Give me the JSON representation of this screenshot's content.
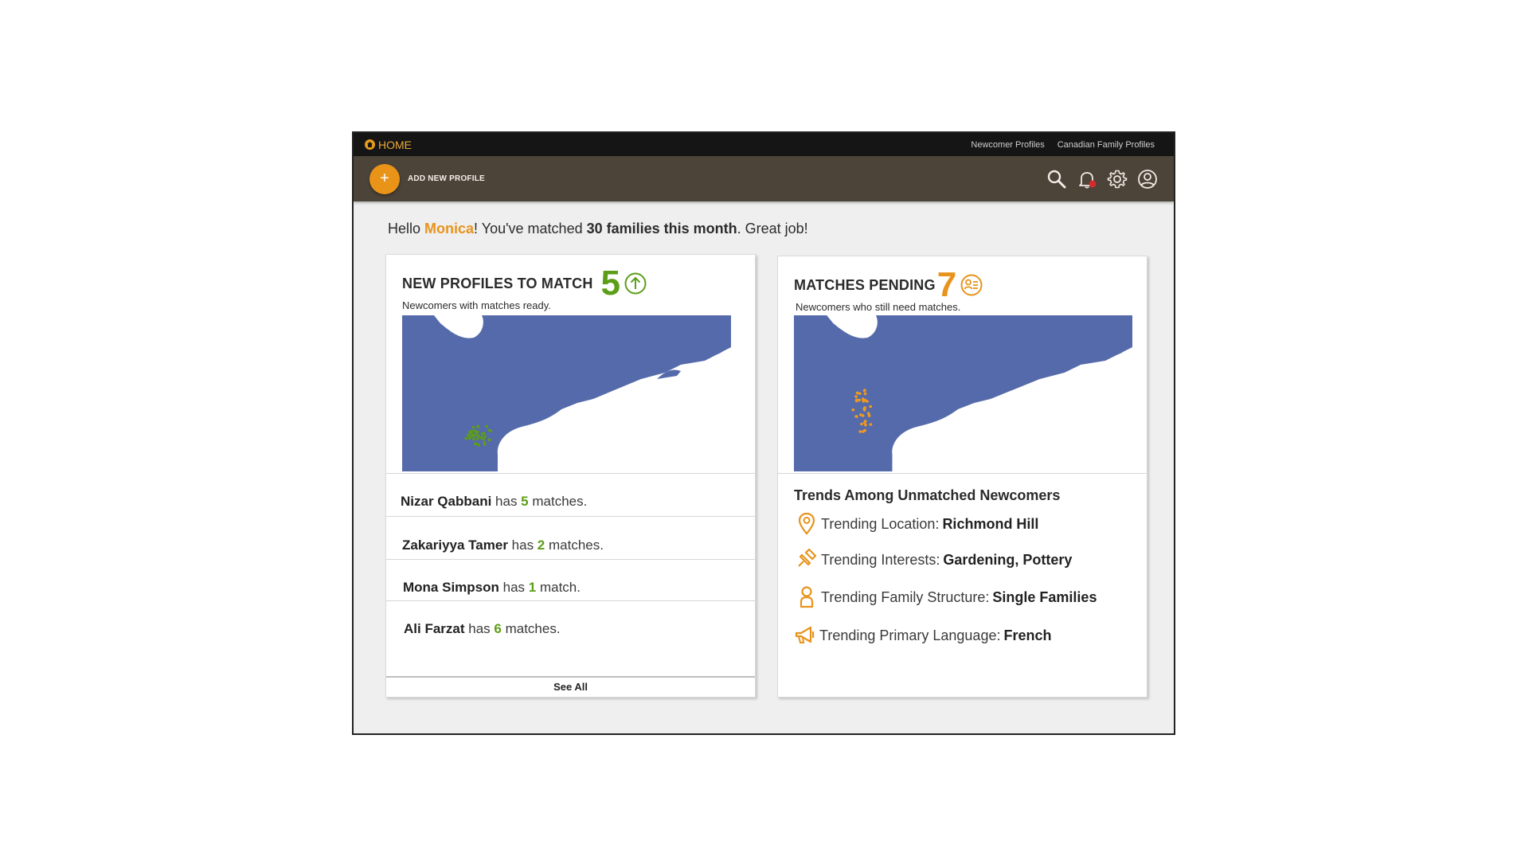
{
  "topbar": {
    "home_label": "HOME",
    "links": [
      "Newcomer Profiles",
      "Canadian Family Profiles"
    ]
  },
  "toolbar": {
    "add_symbol": "+",
    "add_label": "ADD NEW PROFILE",
    "icons": [
      "search-icon",
      "bell-icon",
      "gear-icon",
      "user-icon"
    ],
    "accent": "#e99418",
    "notification_color": "#d42c2c"
  },
  "greeting": {
    "hello": "Hello ",
    "name": "Monica",
    "mid": "! You've matched ",
    "highlight": "30 families this month",
    "end": ". Great job!"
  },
  "new_profiles": {
    "title": "NEW PROFILES TO MATCH",
    "count": "5",
    "subtitle": "Newcomers with matches ready.",
    "dot_color": "#5c9e18",
    "rows": [
      {
        "name": "Nizar Qabbani",
        "has": " has ",
        "count": "5",
        "tail": " matches."
      },
      {
        "name": "Zakariyya Tamer",
        "has": " has ",
        "count": "2",
        "tail": " matches."
      },
      {
        "name": "Mona Simpson",
        "has": " has ",
        "count": "1",
        "tail": " match."
      },
      {
        "name": "Ali Farzat",
        "has": " has ",
        "count": "6",
        "tail": " matches."
      }
    ],
    "see_all": "See All"
  },
  "matches_pending": {
    "title": "MATCHES PENDING",
    "count": "7",
    "subtitle": "Newcomers who still need matches.",
    "dot_color": "#ef9a1e",
    "trends_title": "Trends Among Unmatched Newcomers",
    "trends": [
      {
        "icon": "location-pin-icon",
        "label": "Trending Location: ",
        "value": "Richmond Hill"
      },
      {
        "icon": "pushpin-icon",
        "label": "Trending Interests: ",
        "value": "Gardening, Pottery"
      },
      {
        "icon": "person-icon",
        "label": "Trending Family Structure: ",
        "value": "Single Families"
      },
      {
        "icon": "megaphone-icon",
        "label": "Trending Primary Language: ",
        "value": "French"
      }
    ]
  },
  "map": {
    "water_color": "#556aaa",
    "land_color": "#ffffff"
  }
}
